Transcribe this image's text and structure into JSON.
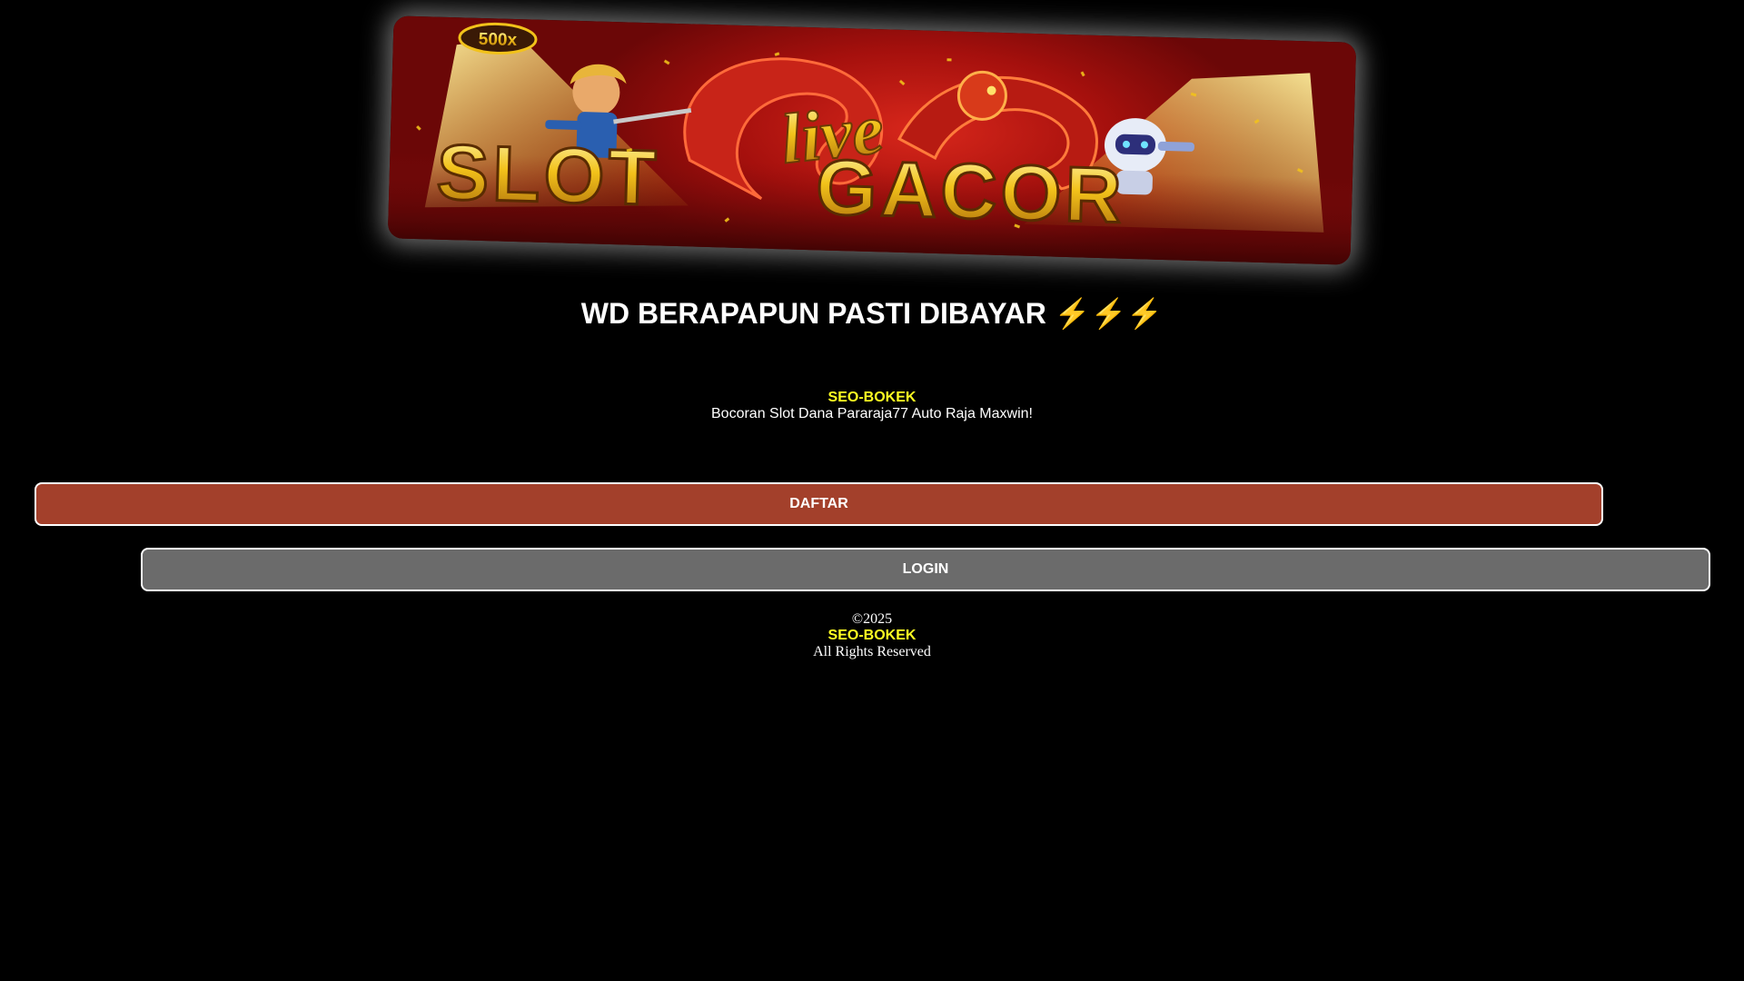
{
  "banner": {
    "badge": "500x",
    "script_word": "live",
    "title_left": "SLOT",
    "title_right": "GACOR"
  },
  "headline": {
    "text": "WD BERAPAPUN PASTI DIBAYAR",
    "bolts": "⚡⚡⚡"
  },
  "brand": {
    "name": "SEO-BOKEK",
    "tagline": "Bocoran Slot Dana Pararaja77 Auto Raja Maxwin!"
  },
  "buttons": {
    "daftar": "DAFTAR",
    "login": "LOGIN"
  },
  "footer": {
    "copyright": "©2025",
    "brand": "SEO-BOKEK",
    "rights": "All Rights Reserved"
  },
  "colors": {
    "background": "#000000",
    "brand_yellow": "#ffff22",
    "daftar_bg": "#a3402b",
    "login_bg": "#6b6b6b",
    "banner_red": "#c11d14",
    "banner_gold": "#f1c21b"
  }
}
